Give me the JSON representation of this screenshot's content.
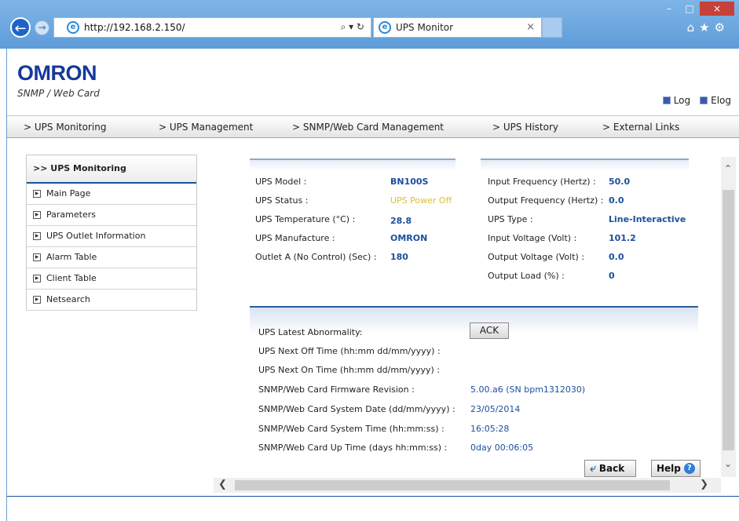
{
  "browser": {
    "address": "http://192.168.2.150/",
    "addr_tools": "⌕ ▾ ↻",
    "tab_title": "UPS Monitor",
    "tab_close": "×",
    "win_min": "–",
    "win_max": "□",
    "win_close": "×",
    "tool_icons": "⌂★⚙"
  },
  "header": {
    "logo": "OMRON",
    "subtitle": "SNMP / Web Card",
    "links": [
      "Log",
      "Elog"
    ]
  },
  "menu": [
    "> UPS Monitoring",
    "> UPS Management",
    "> SNMP/Web Card Management",
    "> UPS History",
    "> External Links"
  ],
  "sidebar": {
    "title": ">>  UPS Monitoring",
    "items": [
      "Main Page",
      "Parameters",
      "UPS Outlet Information",
      "Alarm Table",
      "Client Table",
      "Netsearch"
    ]
  },
  "left_panel": [
    {
      "label": "UPS Model :",
      "value": "BN100S"
    },
    {
      "label": "UPS Status :",
      "value": "UPS Power Off"
    },
    {
      "label": "UPS Temperature (°C) :",
      "value": "28.8"
    },
    {
      "label": "UPS Manufacture :",
      "value": "OMRON"
    },
    {
      "label": "Outlet A (No Control) (Sec) :",
      "value": "180"
    }
  ],
  "right_panel": [
    {
      "label": "Input Frequency (Hertz) :",
      "value": "50.0"
    },
    {
      "label": "Output Frequency (Hertz) :",
      "value": "0.0"
    },
    {
      "label": "UPS Type :",
      "value": "Line-Interactive"
    },
    {
      "label": "Input Voltage (Volt) :",
      "value": "101.2"
    },
    {
      "label": "Output Voltage (Volt) :",
      "value": "0.0"
    },
    {
      "label": "Output Load (%) :",
      "value": "0"
    }
  ],
  "bottom_panel": [
    {
      "label": "UPS Latest Abnormality:",
      "value": ""
    },
    {
      "label": "UPS Next Off Time (hh:mm dd/mm/yyyy) :",
      "value": ""
    },
    {
      "label": "UPS Next On Time (hh:mm dd/mm/yyyy) :",
      "value": ""
    },
    {
      "label": "SNMP/Web Card Firmware Revision :",
      "value": "5.00.a6 (SN bpm1312030)"
    },
    {
      "label": "SNMP/Web Card System Date (dd/mm/yyyy) :",
      "value": "23/05/2014"
    },
    {
      "label": "SNMP/Web Card System Time (hh:mm:ss) :",
      "value": "16:05:28"
    },
    {
      "label": "SNMP/Web Card Up Time (days hh:mm:ss) :",
      "value": "0day 00:06:05"
    }
  ],
  "buttons": {
    "ack": "ACK",
    "back": "Back",
    "help": "Help"
  },
  "colors": {
    "brand": "#15399a",
    "value_blue": "#1c4f9c",
    "status_off": "#d8c232"
  }
}
